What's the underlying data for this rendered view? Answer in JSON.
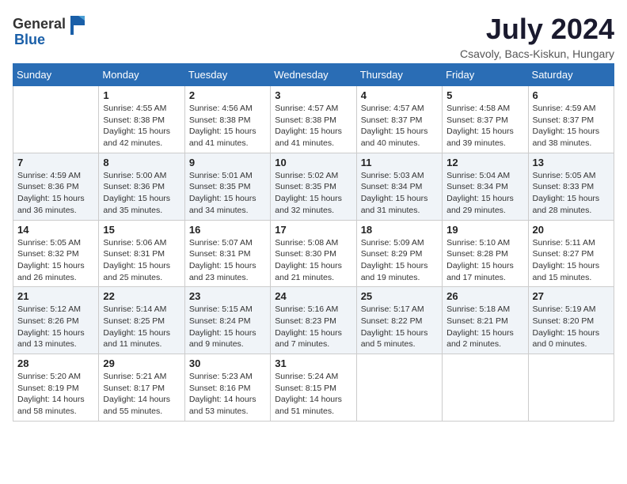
{
  "header": {
    "logo_general": "General",
    "logo_blue": "Blue",
    "month_title": "July 2024",
    "location": "Csavoly, Bacs-Kiskun, Hungary"
  },
  "weekdays": [
    "Sunday",
    "Monday",
    "Tuesday",
    "Wednesday",
    "Thursday",
    "Friday",
    "Saturday"
  ],
  "weeks": [
    [
      {
        "day": "",
        "info": ""
      },
      {
        "day": "1",
        "info": "Sunrise: 4:55 AM\nSunset: 8:38 PM\nDaylight: 15 hours\nand 42 minutes."
      },
      {
        "day": "2",
        "info": "Sunrise: 4:56 AM\nSunset: 8:38 PM\nDaylight: 15 hours\nand 41 minutes."
      },
      {
        "day": "3",
        "info": "Sunrise: 4:57 AM\nSunset: 8:38 PM\nDaylight: 15 hours\nand 41 minutes."
      },
      {
        "day": "4",
        "info": "Sunrise: 4:57 AM\nSunset: 8:37 PM\nDaylight: 15 hours\nand 40 minutes."
      },
      {
        "day": "5",
        "info": "Sunrise: 4:58 AM\nSunset: 8:37 PM\nDaylight: 15 hours\nand 39 minutes."
      },
      {
        "day": "6",
        "info": "Sunrise: 4:59 AM\nSunset: 8:37 PM\nDaylight: 15 hours\nand 38 minutes."
      }
    ],
    [
      {
        "day": "7",
        "info": "Sunrise: 4:59 AM\nSunset: 8:36 PM\nDaylight: 15 hours\nand 36 minutes."
      },
      {
        "day": "8",
        "info": "Sunrise: 5:00 AM\nSunset: 8:36 PM\nDaylight: 15 hours\nand 35 minutes."
      },
      {
        "day": "9",
        "info": "Sunrise: 5:01 AM\nSunset: 8:35 PM\nDaylight: 15 hours\nand 34 minutes."
      },
      {
        "day": "10",
        "info": "Sunrise: 5:02 AM\nSunset: 8:35 PM\nDaylight: 15 hours\nand 32 minutes."
      },
      {
        "day": "11",
        "info": "Sunrise: 5:03 AM\nSunset: 8:34 PM\nDaylight: 15 hours\nand 31 minutes."
      },
      {
        "day": "12",
        "info": "Sunrise: 5:04 AM\nSunset: 8:34 PM\nDaylight: 15 hours\nand 29 minutes."
      },
      {
        "day": "13",
        "info": "Sunrise: 5:05 AM\nSunset: 8:33 PM\nDaylight: 15 hours\nand 28 minutes."
      }
    ],
    [
      {
        "day": "14",
        "info": "Sunrise: 5:05 AM\nSunset: 8:32 PM\nDaylight: 15 hours\nand 26 minutes."
      },
      {
        "day": "15",
        "info": "Sunrise: 5:06 AM\nSunset: 8:31 PM\nDaylight: 15 hours\nand 25 minutes."
      },
      {
        "day": "16",
        "info": "Sunrise: 5:07 AM\nSunset: 8:31 PM\nDaylight: 15 hours\nand 23 minutes."
      },
      {
        "day": "17",
        "info": "Sunrise: 5:08 AM\nSunset: 8:30 PM\nDaylight: 15 hours\nand 21 minutes."
      },
      {
        "day": "18",
        "info": "Sunrise: 5:09 AM\nSunset: 8:29 PM\nDaylight: 15 hours\nand 19 minutes."
      },
      {
        "day": "19",
        "info": "Sunrise: 5:10 AM\nSunset: 8:28 PM\nDaylight: 15 hours\nand 17 minutes."
      },
      {
        "day": "20",
        "info": "Sunrise: 5:11 AM\nSunset: 8:27 PM\nDaylight: 15 hours\nand 15 minutes."
      }
    ],
    [
      {
        "day": "21",
        "info": "Sunrise: 5:12 AM\nSunset: 8:26 PM\nDaylight: 15 hours\nand 13 minutes."
      },
      {
        "day": "22",
        "info": "Sunrise: 5:14 AM\nSunset: 8:25 PM\nDaylight: 15 hours\nand 11 minutes."
      },
      {
        "day": "23",
        "info": "Sunrise: 5:15 AM\nSunset: 8:24 PM\nDaylight: 15 hours\nand 9 minutes."
      },
      {
        "day": "24",
        "info": "Sunrise: 5:16 AM\nSunset: 8:23 PM\nDaylight: 15 hours\nand 7 minutes."
      },
      {
        "day": "25",
        "info": "Sunrise: 5:17 AM\nSunset: 8:22 PM\nDaylight: 15 hours\nand 5 minutes."
      },
      {
        "day": "26",
        "info": "Sunrise: 5:18 AM\nSunset: 8:21 PM\nDaylight: 15 hours\nand 2 minutes."
      },
      {
        "day": "27",
        "info": "Sunrise: 5:19 AM\nSunset: 8:20 PM\nDaylight: 15 hours\nand 0 minutes."
      }
    ],
    [
      {
        "day": "28",
        "info": "Sunrise: 5:20 AM\nSunset: 8:19 PM\nDaylight: 14 hours\nand 58 minutes."
      },
      {
        "day": "29",
        "info": "Sunrise: 5:21 AM\nSunset: 8:17 PM\nDaylight: 14 hours\nand 55 minutes."
      },
      {
        "day": "30",
        "info": "Sunrise: 5:23 AM\nSunset: 8:16 PM\nDaylight: 14 hours\nand 53 minutes."
      },
      {
        "day": "31",
        "info": "Sunrise: 5:24 AM\nSunset: 8:15 PM\nDaylight: 14 hours\nand 51 minutes."
      },
      {
        "day": "",
        "info": ""
      },
      {
        "day": "",
        "info": ""
      },
      {
        "day": "",
        "info": ""
      }
    ]
  ]
}
